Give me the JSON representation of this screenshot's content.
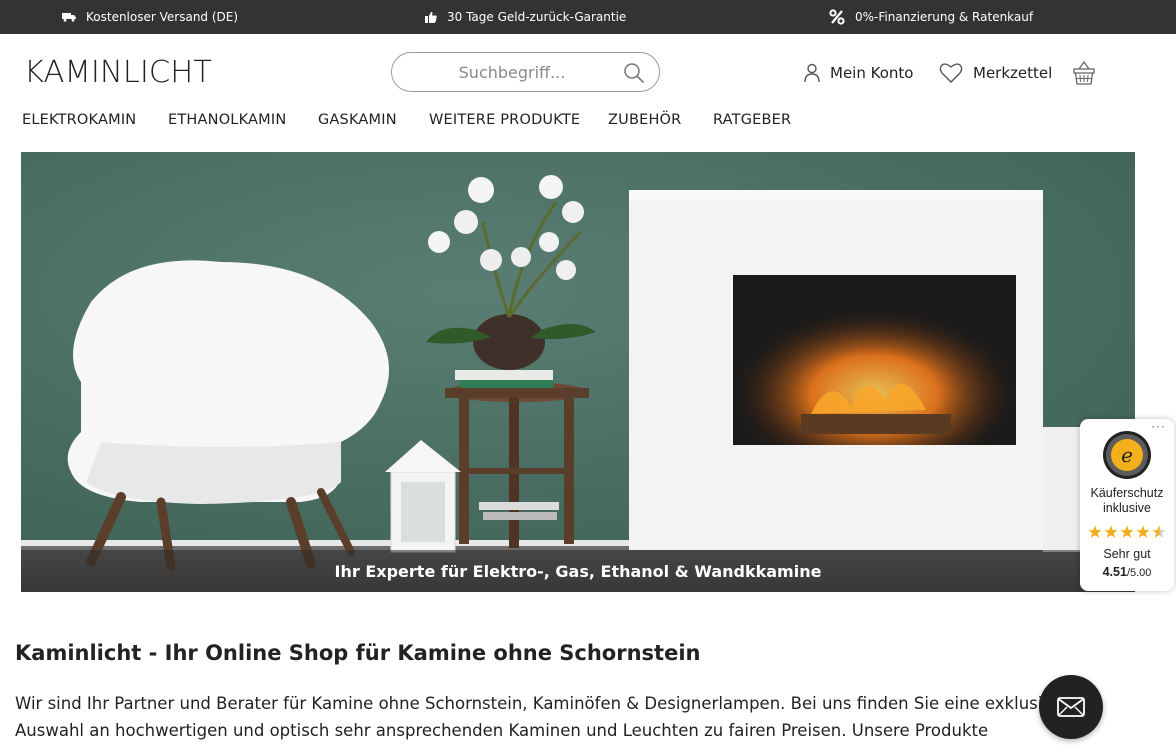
{
  "topbar": {
    "usp1": "Kostenloser Versand (DE)",
    "usp2": "30 Tage Geld-zurück-Garantie",
    "usp3": "0%-Finanzierung & Ratenkauf",
    "icons": [
      "truck-icon",
      "thumbs-up-icon",
      "percent-icon"
    ]
  },
  "header": {
    "logo_text": "KAMINLICHT",
    "search_placeholder": "Suchbegriff...",
    "account_label": "Mein Konto",
    "wishlist_label": "Merkzettel"
  },
  "nav": {
    "items": [
      "ELEKTROKAMIN",
      "ETHANOLKAMIN",
      "GASKAMIN",
      "WEITERE PRODUKTE",
      "ZUBEHÖR",
      "RATGEBER"
    ]
  },
  "hero": {
    "caption": "Ihr Experte für Elektro-, Gas, Ethanol & Wandkkamine"
  },
  "trustbadge": {
    "protection_line1": "Käuferschutz",
    "protection_line2": "inklusive",
    "grade": "Sehr gut",
    "score": "4.51",
    "max": "/5.00",
    "rating": 4.51
  },
  "content": {
    "heading": "Kaminlicht - Ihr Online Shop für Kamine ohne Schornstein",
    "intro": "Wir sind Ihr Partner und Berater für Kamine ohne Schornstein, Kaminöfen & Designerlampen. Bei uns finden Sie eine exklusive Auswahl an hochwertigen und optisch sehr ansprechenden Kaminen und Leuchten zu fairen Preisen. Unsere Produkte entsprechen"
  },
  "colors": {
    "topbar_bg": "#333333",
    "wall": "#46695f",
    "star": "#f3b01a"
  }
}
